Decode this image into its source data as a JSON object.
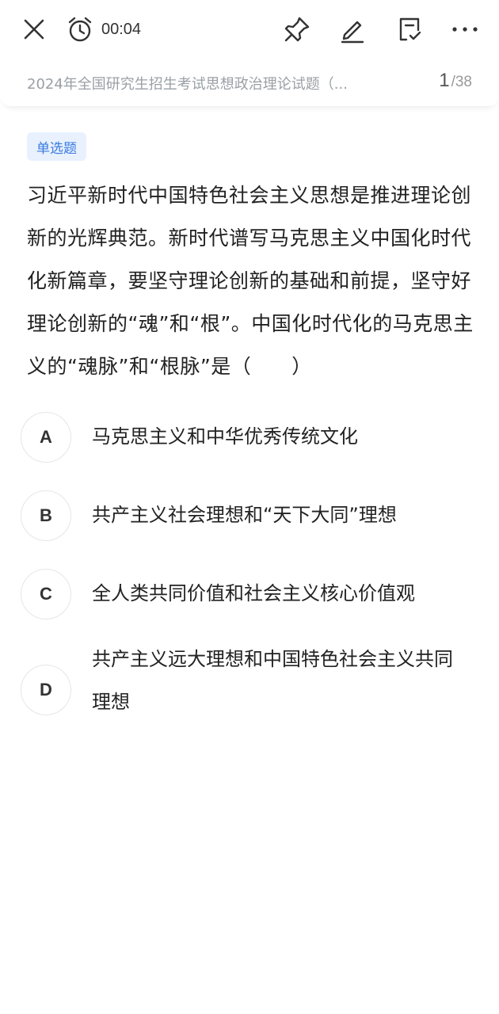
{
  "toolbar": {
    "timer": "00:04",
    "icons": [
      "close-icon",
      "alarm-clock-icon",
      "pin-icon",
      "pencil-icon",
      "answer-sheet-icon",
      "more-icon"
    ]
  },
  "header": {
    "paper_title": "2024年全国研究生招生考试思想政治理论试题（...",
    "current": "1",
    "total": "/38"
  },
  "question": {
    "type": "单选题",
    "stem": "习近平新时代中国特色社会主义思想是推进理论创新的光辉典范。新时代谱写马克思主义中国化时代化新篇章，要坚守理论创新的基础和前提，坚守好理论创新的“魂”和“根”。中国化时代化的马克思主义的“魂脉”和“根脉”是（　　）",
    "options": [
      {
        "letter": "A",
        "text": "马克思主义和中华优秀传统文化"
      },
      {
        "letter": "B",
        "text": "共产主义社会理想和“天下大同”理想"
      },
      {
        "letter": "C",
        "text": "全人类共同价值和社会主义核心价值观"
      },
      {
        "letter": "D",
        "text": "共产主义远大理想和中国特色社会主义共同理想"
      }
    ]
  },
  "colors": {
    "tag_bg": "#e8f1fd",
    "tag_text": "#3b7be0",
    "title_gray": "#9aa0a6"
  }
}
